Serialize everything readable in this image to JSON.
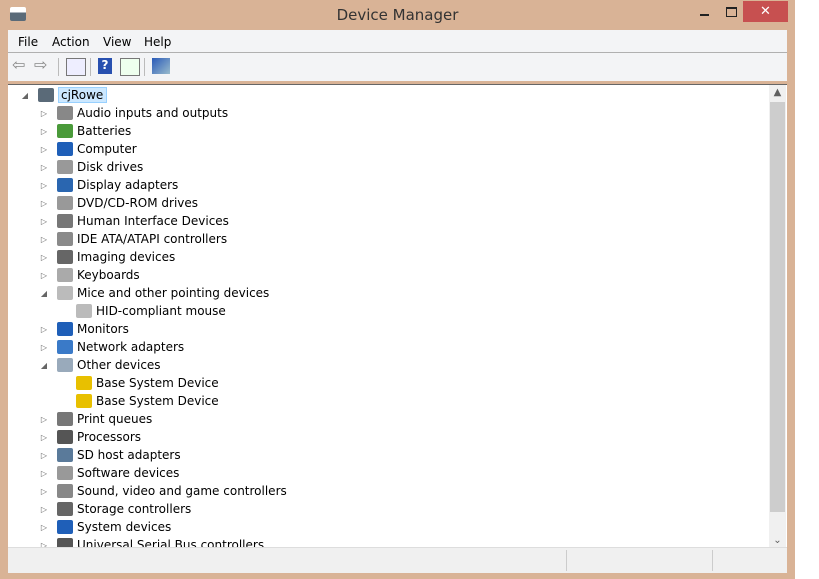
{
  "window": {
    "title": "Device Manager",
    "close": "✕"
  },
  "menu": [
    "File",
    "Action",
    "View",
    "Help"
  ],
  "toolbar": {
    "help": "?"
  },
  "tree": {
    "root": "cjRowe",
    "items": [
      {
        "label": "Audio inputs and outputs",
        "icon": "speaker-icon",
        "color": "#888",
        "expanded": false
      },
      {
        "label": "Batteries",
        "icon": "battery-icon",
        "color": "#4a9a3a",
        "expanded": false
      },
      {
        "label": "Computer",
        "icon": "computer-icon",
        "color": "#1f5fb8",
        "expanded": false
      },
      {
        "label": "Disk drives",
        "icon": "disk-drive-icon",
        "color": "#999",
        "expanded": false
      },
      {
        "label": "Display adapters",
        "icon": "display-adapter-icon",
        "color": "#2a66b0",
        "expanded": false
      },
      {
        "label": "DVD/CD-ROM drives",
        "icon": "dvd-icon",
        "color": "#999",
        "expanded": false
      },
      {
        "label": "Human Interface Devices",
        "icon": "hid-icon",
        "color": "#777",
        "expanded": false
      },
      {
        "label": "IDE ATA/ATAPI controllers",
        "icon": "ide-icon",
        "color": "#8a8a8a",
        "expanded": false
      },
      {
        "label": "Imaging devices",
        "icon": "camera-icon",
        "color": "#666",
        "expanded": false
      },
      {
        "label": "Keyboards",
        "icon": "keyboard-icon",
        "color": "#aaa",
        "expanded": false
      },
      {
        "label": "Mice and other pointing devices",
        "icon": "mouse-icon",
        "color": "#bbb",
        "expanded": true,
        "children": [
          {
            "label": "HID-compliant mouse",
            "icon": "mouse-icon",
            "color": "#bbb"
          }
        ]
      },
      {
        "label": "Monitors",
        "icon": "monitor-icon",
        "color": "#1f5fb8",
        "expanded": false
      },
      {
        "label": "Network adapters",
        "icon": "network-icon",
        "color": "#3a7ac8",
        "expanded": false
      },
      {
        "label": "Other devices",
        "icon": "unknown-device-icon",
        "color": "#9ab",
        "expanded": true,
        "children": [
          {
            "label": "Base System Device",
            "icon": "warning-icon",
            "color": "#e8c000"
          },
          {
            "label": "Base System Device",
            "icon": "warning-icon",
            "color": "#e8c000"
          }
        ]
      },
      {
        "label": "Print queues",
        "icon": "printer-icon",
        "color": "#777",
        "expanded": false
      },
      {
        "label": "Processors",
        "icon": "processor-icon",
        "color": "#555",
        "expanded": false
      },
      {
        "label": "SD host adapters",
        "icon": "sd-icon",
        "color": "#5a7a9a",
        "expanded": false
      },
      {
        "label": "Software devices",
        "icon": "software-device-icon",
        "color": "#999",
        "expanded": false
      },
      {
        "label": "Sound, video and game controllers",
        "icon": "sound-icon",
        "color": "#888",
        "expanded": false
      },
      {
        "label": "Storage controllers",
        "icon": "storage-icon",
        "color": "#666",
        "expanded": false
      },
      {
        "label": "System devices",
        "icon": "system-icon",
        "color": "#1f5fb8",
        "expanded": false
      },
      {
        "label": "Universal Serial Bus controllers",
        "icon": "usb-icon",
        "color": "#555",
        "expanded": false
      }
    ]
  }
}
